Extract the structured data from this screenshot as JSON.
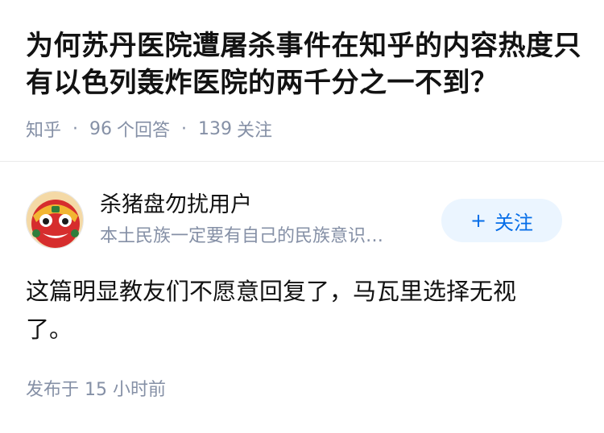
{
  "question": {
    "title": "为何苏丹医院遭屠杀事件在知乎的内容热度只有以色列轰炸医院的两千分之一不到？",
    "meta": {
      "source": "知乎",
      "answer_count": "96",
      "answer_label": "个回答",
      "follow_count": "139",
      "follow_label": "关注",
      "separator": "·"
    }
  },
  "answer": {
    "author": {
      "name": "杀猪盘勿扰用户",
      "bio": "本土民族一定要有自己的民族意识…",
      "avatar_icon": "lion-dance-avatar"
    },
    "follow_button": {
      "plus": "+",
      "label": "关注"
    },
    "content": "这篇明显教友们不愿意回复了，马瓦里选择无视了。",
    "time": "发布于  15 小时前"
  },
  "colors": {
    "title": "#121212",
    "meta": "#8590a6",
    "accent": "#056de8",
    "follow_bg": "#ebf5ff",
    "divider": "#ebebeb"
  }
}
